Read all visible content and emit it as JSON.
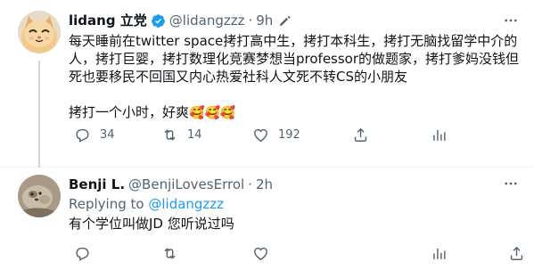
{
  "tweets": [
    {
      "author": "lidang 立党",
      "handle": "@lidangzzz",
      "separator": "·",
      "time": "9h",
      "text_p1": "每天睡前在twitter space拷打高中生，拷打本科生，拷打无脑找留学中介的人，拷打巨婴，拷打数理化竞赛梦想当professor的做题家，拷打爹妈没钱但死也要移民不回国又内心热爱社科人文死不转CS的小朋友",
      "text_p2": "拷打一个小时，好爽",
      "text_emoji": "🥰🥰🥰",
      "replies": "34",
      "retweets": "14",
      "likes": "192",
      "icons": [
        "more-icon",
        "verified-icon",
        "edit-icon",
        "reply-icon",
        "retweet-icon",
        "like-icon",
        "share-icon",
        "analytics-icon"
      ]
    },
    {
      "author": "Benji L.",
      "handle": "@BenjiLovesErrol",
      "separator": "·",
      "time": "2h",
      "replying_label": "Replying to",
      "replying_to": "@lidangzzz",
      "text": "有个学位叫做JD 您听说过吗",
      "icons": [
        "more-icon",
        "reply-icon",
        "retweet-icon",
        "like-icon",
        "analytics-icon",
        "share-icon"
      ]
    }
  ],
  "colors": {
    "accent": "#1d9bf0",
    "secondary_text": "#536471",
    "primary_text": "#0f1419",
    "thread_line": "#cfd9de"
  }
}
